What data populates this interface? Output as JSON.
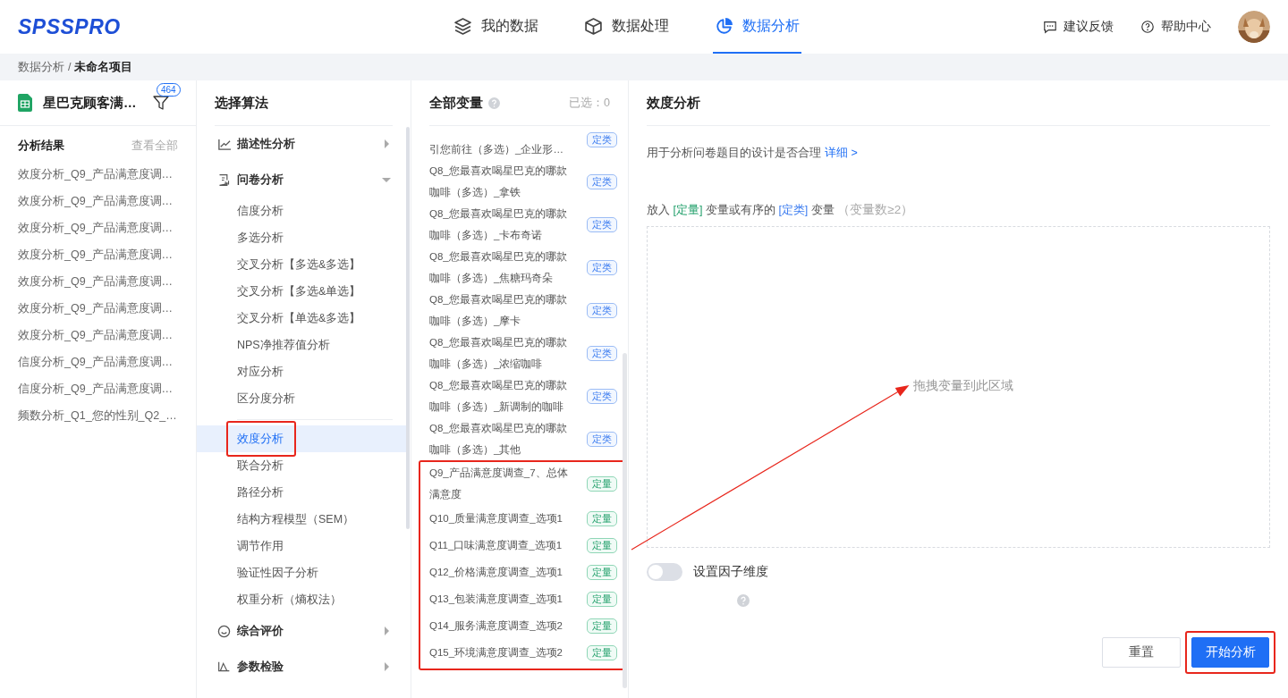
{
  "header": {
    "logo": "SPSSPRO",
    "nav": [
      {
        "label": "我的数据",
        "selected": false
      },
      {
        "label": "数据处理",
        "selected": false
      },
      {
        "label": "数据分析",
        "selected": true
      }
    ],
    "links": [
      "建议反馈",
      "帮助中心"
    ]
  },
  "breadcrumb": {
    "separator": "/",
    "items": [
      {
        "label": "数据分析",
        "current": false
      },
      {
        "label": "未命名项目",
        "current": true
      }
    ]
  },
  "file_panel": {
    "file_name": "星巴克顾客满…",
    "filter_count": "464",
    "results_title": "分析结果",
    "view_all": "查看全部",
    "results": [
      "效度分析_Q9_产品满意度调…",
      "效度分析_Q9_产品满意度调…",
      "效度分析_Q9_产品满意度调…",
      "效度分析_Q9_产品满意度调…",
      "效度分析_Q9_产品满意度调…",
      "效度分析_Q9_产品满意度调…",
      "效度分析_Q9_产品满意度调…",
      "信度分析_Q9_产品满意度调…",
      "信度分析_Q9_产品满意度调…",
      "频数分析_Q1_您的性别_Q2_…"
    ]
  },
  "algorithms": {
    "title": "选择算法",
    "sections": [
      {
        "label": "描述性分析",
        "expanded": false
      },
      {
        "label": "问卷分析",
        "expanded": true,
        "children": [
          {
            "label": "信度分析",
            "selected": false
          },
          {
            "label": "多选分析",
            "selected": false
          },
          {
            "label": "交叉分析【多选&多选】",
            "selected": false
          },
          {
            "label": "交叉分析【多选&单选】",
            "selected": false
          },
          {
            "label": "交叉分析【单选&多选】",
            "selected": false
          },
          {
            "label": "NPS净推荐值分析",
            "selected": false
          },
          {
            "label": "对应分析",
            "selected": false
          },
          {
            "label": "区分度分析",
            "selected": false,
            "divider_after": true
          },
          {
            "label": "效度分析",
            "selected": true,
            "highlighted": true
          },
          {
            "label": "联合分析",
            "selected": false
          },
          {
            "label": "路径分析",
            "selected": false
          },
          {
            "label": "结构方程模型（SEM）",
            "selected": false
          },
          {
            "label": "调节作用",
            "selected": false
          },
          {
            "label": "验证性因子分析",
            "selected": false
          },
          {
            "label": "权重分析（熵权法）",
            "selected": false
          }
        ]
      },
      {
        "label": "综合评价",
        "expanded": false
      },
      {
        "label": "参数检验",
        "expanded": false
      }
    ]
  },
  "variables": {
    "title": "全部变量",
    "selected_count": "已选：0",
    "items": [
      {
        "lines": [
          "引您前往（多选）_企业形…"
        ],
        "cut_top": true,
        "tag": "定类",
        "kind": "nominal"
      },
      {
        "lines": [
          "Q8_您最喜欢喝星巴克的哪款",
          "咖啡（多选）_拿铁"
        ],
        "tag": "定类",
        "kind": "nominal"
      },
      {
        "lines": [
          "Q8_您最喜欢喝星巴克的哪款",
          "咖啡（多选）_卡布奇诺"
        ],
        "tag": "定类",
        "kind": "nominal"
      },
      {
        "lines": [
          "Q8_您最喜欢喝星巴克的哪款",
          "咖啡（多选）_焦糖玛奇朵"
        ],
        "tag": "定类",
        "kind": "nominal"
      },
      {
        "lines": [
          "Q8_您最喜欢喝星巴克的哪款",
          "咖啡（多选）_摩卡"
        ],
        "tag": "定类",
        "kind": "nominal"
      },
      {
        "lines": [
          "Q8_您最喜欢喝星巴克的哪款",
          "咖啡（多选）_浓缩咖啡"
        ],
        "tag": "定类",
        "kind": "nominal"
      },
      {
        "lines": [
          "Q8_您最喜欢喝星巴克的哪款",
          "咖啡（多选）_新调制的咖啡"
        ],
        "tag": "定类",
        "kind": "nominal"
      },
      {
        "lines": [
          "Q8_您最喜欢喝星巴克的哪款",
          "咖啡（多选）_其他"
        ],
        "tag": "定类",
        "kind": "nominal"
      },
      {
        "lines": [
          "Q9_产品满意度调查_7、总体",
          "满意度"
        ],
        "tag": "定量",
        "kind": "scale",
        "highlighted": true
      },
      {
        "lines": [
          "Q10_质量满意度调查_选项1"
        ],
        "tag": "定量",
        "kind": "scale",
        "highlighted": true
      },
      {
        "lines": [
          "Q11_口味满意度调查_选项1"
        ],
        "tag": "定量",
        "kind": "scale",
        "highlighted": true
      },
      {
        "lines": [
          "Q12_价格满意度调查_选项1"
        ],
        "tag": "定量",
        "kind": "scale",
        "highlighted": true
      },
      {
        "lines": [
          "Q13_包装满意度调查_选项1"
        ],
        "tag": "定量",
        "kind": "scale",
        "highlighted": true
      },
      {
        "lines": [
          "Q14_服务满意度调查_选项2"
        ],
        "tag": "定量",
        "kind": "scale",
        "highlighted": true
      },
      {
        "lines": [
          "Q15_环境满意度调查_选项2"
        ],
        "tag": "定量",
        "kind": "scale",
        "highlighted": true
      }
    ]
  },
  "analysis": {
    "title": "效度分析",
    "description": "用于分析问卷题目的设计是否合理",
    "detail_link": "详细 >",
    "instruction": [
      {
        "text": "放入 ",
        "kind": "plain"
      },
      {
        "text": "[定量]",
        "kind": "scale"
      },
      {
        "text": " 变量或有序的 ",
        "kind": "plain"
      },
      {
        "text": "[定类]",
        "kind": "nominal"
      },
      {
        "text": " 变量 ",
        "kind": "plain"
      },
      {
        "text": "（变量数≥2）",
        "kind": "muted"
      }
    ],
    "drop_hint": "拖拽变量到此区域",
    "arrow_annotation": true,
    "factor_toggle": {
      "label": "设置因子维度",
      "on": false
    },
    "buttons": [
      {
        "label": "重置",
        "kind": "secondary",
        "highlighted": false
      },
      {
        "label": "开始分析",
        "kind": "primary",
        "highlighted": true
      }
    ]
  }
}
